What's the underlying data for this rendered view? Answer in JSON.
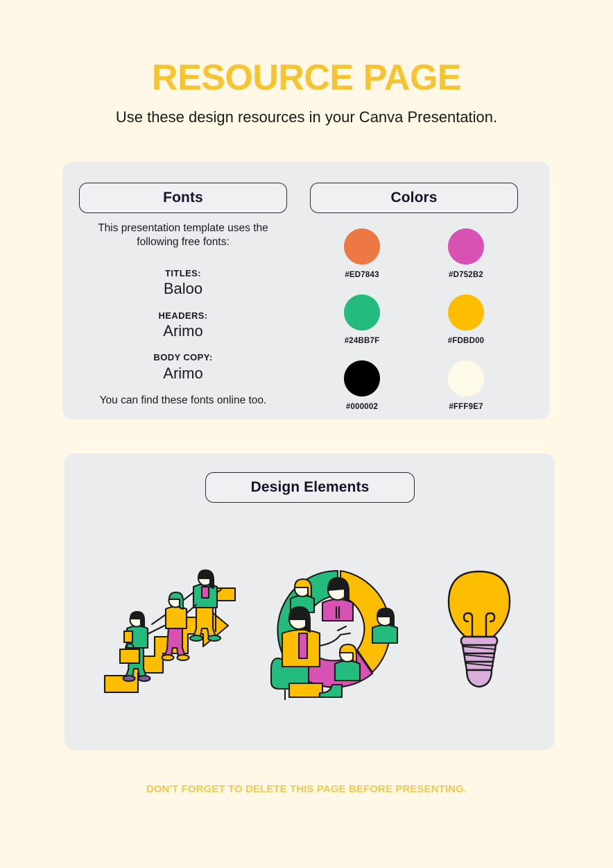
{
  "header": {
    "title": "RESOURCE PAGE",
    "subtitle": "Use these design resources in your Canva Presentation."
  },
  "fonts_panel": {
    "pill_label": "Fonts",
    "intro": "This presentation template uses the following free fonts:",
    "entries": [
      {
        "label": "TITLES:",
        "font": "Baloo"
      },
      {
        "label": "HEADERS:",
        "font": "Arimo"
      },
      {
        "label": "BODY COPY:",
        "font": "Arimo"
      }
    ],
    "outro": "You can find these fonts online too."
  },
  "colors_panel": {
    "pill_label": "Colors",
    "swatches": [
      {
        "hex": "#ED7843",
        "name": "orange"
      },
      {
        "hex": "#D752B2",
        "name": "magenta"
      },
      {
        "hex": "#24BB7F",
        "name": "green"
      },
      {
        "hex": "#FDBD00",
        "name": "yellow"
      },
      {
        "hex": "#000002",
        "name": "black"
      },
      {
        "hex": "#FFF9E7",
        "name": "cream"
      }
    ]
  },
  "design_panel": {
    "pill_label": "Design Elements",
    "illustrations": [
      {
        "name": "people-climbing-growth-arrow-illustration"
      },
      {
        "name": "team-collaboration-circle-illustration"
      },
      {
        "name": "lightbulb-idea-illustration"
      }
    ]
  },
  "footer": {
    "note": "DON'T FORGET TO DELETE THIS PAGE BEFORE PRESENTING."
  },
  "theme": {
    "background": "#FFF8E7",
    "panel_background": "#EBECEE",
    "title_color": "#F5C430",
    "footer_color": "#F0C94F",
    "ink": "#14142B"
  }
}
